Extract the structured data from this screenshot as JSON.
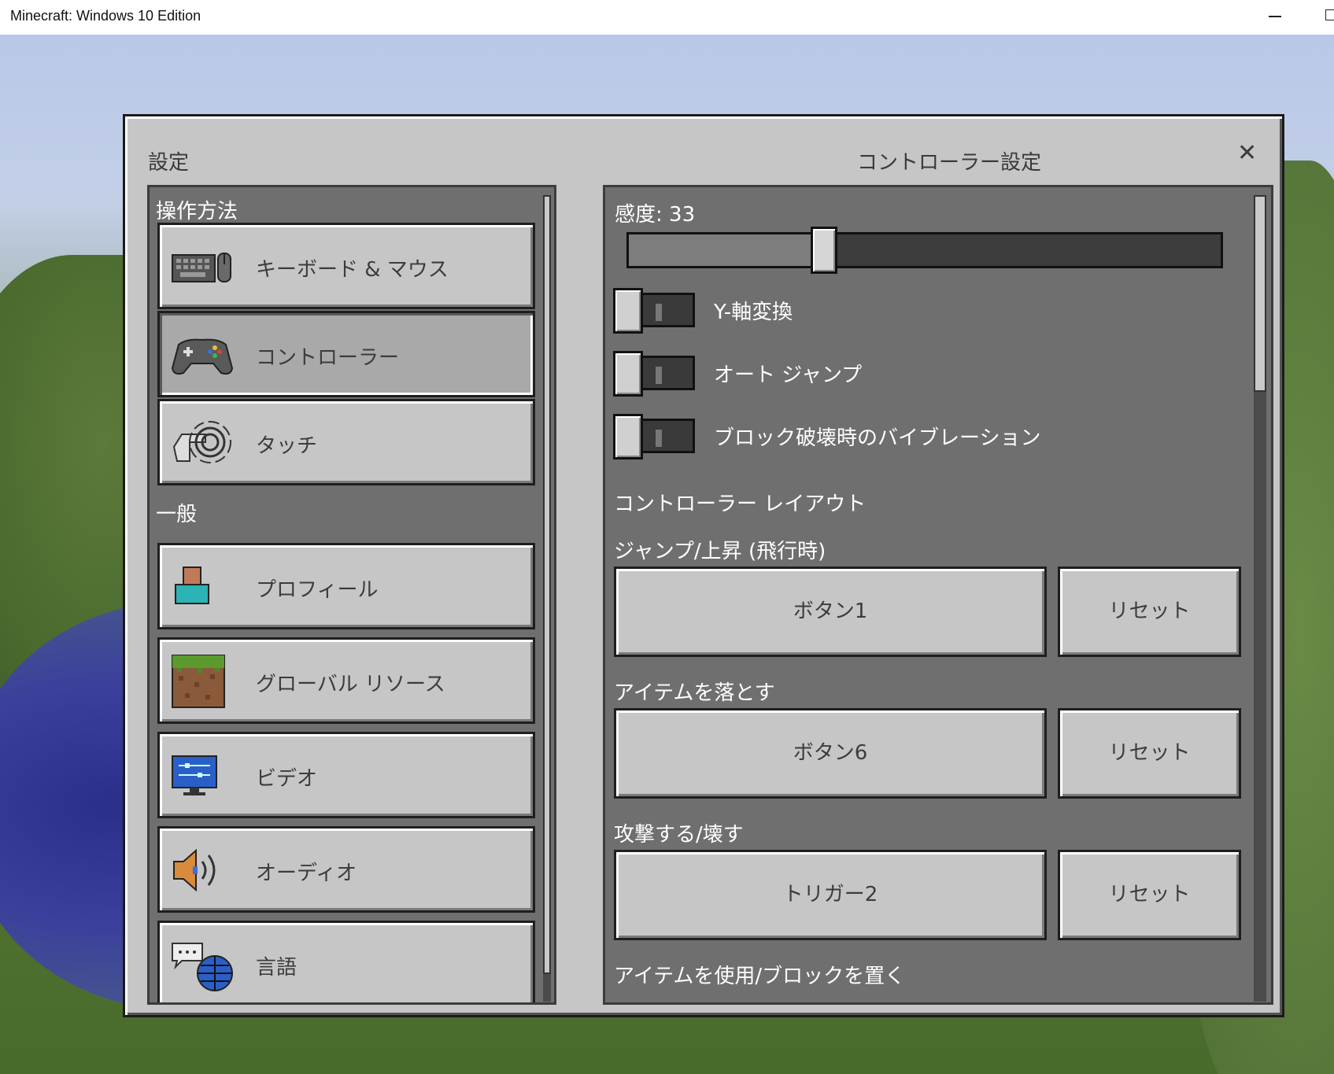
{
  "window": {
    "title": "Minecraft: Windows 10 Edition"
  },
  "dialog": {
    "left_title": "設定",
    "right_title": "コントローラー設定",
    "close_label": "✕"
  },
  "left": {
    "section_controls": "操作方法",
    "section_general": "一般",
    "items": [
      {
        "label": "キーボード & マウス",
        "icon": "keyboard-mouse-icon"
      },
      {
        "label": "コントローラー",
        "icon": "gamepad-icon",
        "selected": true
      },
      {
        "label": "タッチ",
        "icon": "touch-hand-icon"
      },
      {
        "label": "プロフィール",
        "icon": "profile-icon"
      },
      {
        "label": "グローバル リソース",
        "icon": "grass-block-icon"
      },
      {
        "label": "ビデオ",
        "icon": "monitor-icon"
      },
      {
        "label": "オーディオ",
        "icon": "speaker-icon"
      },
      {
        "label": "言語",
        "icon": "language-globe-icon"
      }
    ]
  },
  "right": {
    "sensitivity_label": "感度: 33",
    "sensitivity_value": 0.33,
    "toggles": [
      {
        "label": "Y-軸変換",
        "on": false
      },
      {
        "label": "オート ジャンプ",
        "on": false
      },
      {
        "label": "ブロック破壊時のバイブレーション",
        "on": false
      }
    ],
    "layout_title": "コントローラー レイアウト",
    "bindings": [
      {
        "action": "ジャンプ/上昇 (飛行時)",
        "button": "ボタン1",
        "reset": "リセット"
      },
      {
        "action": "アイテムを落とす",
        "button": "ボタン6",
        "reset": "リセット"
      },
      {
        "action": "攻撃する/壊す",
        "button": "トリガー2",
        "reset": "リセット"
      }
    ],
    "next_action": "アイテムを使用/ブロックを置く"
  }
}
